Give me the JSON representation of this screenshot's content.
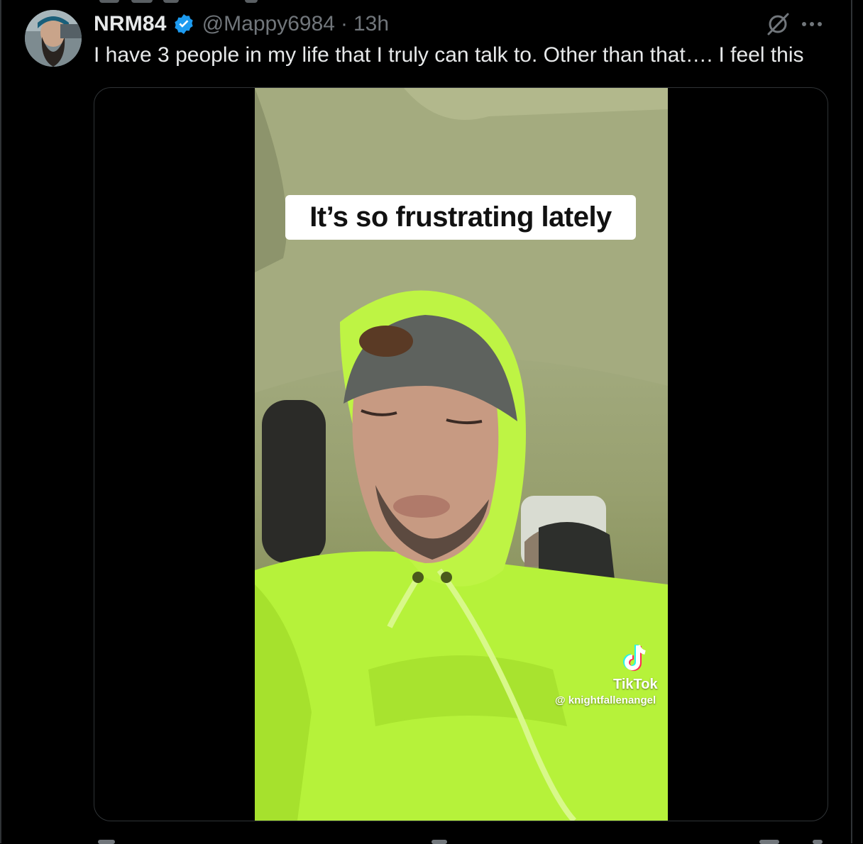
{
  "tweet": {
    "display_name": "NRM84",
    "handle": "@Mappy6984",
    "separator": "·",
    "time": "13h",
    "text": "I have 3 people in my life that I truly can talk to. Other than that…. I feel this",
    "verified": true
  },
  "video": {
    "caption": "It’s so frustrating lately",
    "watermark_brand": "TikTok",
    "watermark_user": "@ knightfallenangel"
  },
  "icons": {
    "verified": "verified-badge-icon",
    "grok": "grok-icon",
    "more": "more-icon",
    "tiktok": "tiktok-logo-icon"
  },
  "colors": {
    "background": "#000000",
    "text_primary": "#e7e9ea",
    "text_secondary": "#71767b",
    "verified_blue": "#1d9bf0",
    "hoodie_green": "#b6f23a"
  }
}
